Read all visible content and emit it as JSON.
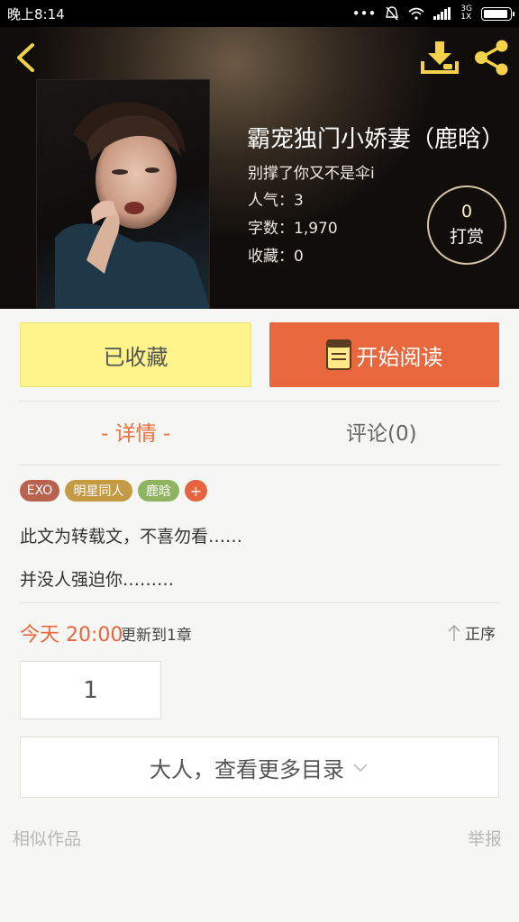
{
  "status_bar": {
    "time": "晚上8:14",
    "signal_text": "3G\n1X",
    "icons": [
      "more-dots-icon",
      "mute-icon",
      "wifi-icon",
      "signal-icon",
      "battery-icon"
    ]
  },
  "header": {
    "title": "霸宠独门小娇妻（鹿晗）",
    "author": "别撑了你又不是伞i",
    "popularity": "人气：3",
    "word_count": "字数：1,970",
    "favorites": "收藏：0",
    "reward_count": "0",
    "reward_label": "打赏",
    "icons": [
      "back-icon",
      "download-icon",
      "share-icon"
    ]
  },
  "actions": {
    "collected_label": "已收藏",
    "read_label": "开始阅读"
  },
  "tabs": [
    {
      "label": "- 详情 -",
      "active": true
    },
    {
      "label": "评论(0)",
      "active": false
    }
  ],
  "tags": [
    {
      "label": "EXO",
      "color": "#b8624f"
    },
    {
      "label": "明星同人",
      "color": "#c49a45"
    },
    {
      "label": "鹿晗",
      "color": "#8eb461"
    },
    {
      "label": "+",
      "color": "#e5643f"
    }
  ],
  "description": [
    "此文为转载文，不喜勿看……",
    "并没人强迫你………"
  ],
  "update": {
    "time": "今天 20:00",
    "text": "更新到1章",
    "sort_label": "正序"
  },
  "chapters": [
    "1"
  ],
  "more_catalog_label": "大人，查看更多目录",
  "footer": {
    "similar_label": "相似作品",
    "report_label": "举报"
  },
  "colors": {
    "accent": "#e9673c",
    "collected_bg": "#fdf48b",
    "reward_border": "#d7c6a3"
  }
}
